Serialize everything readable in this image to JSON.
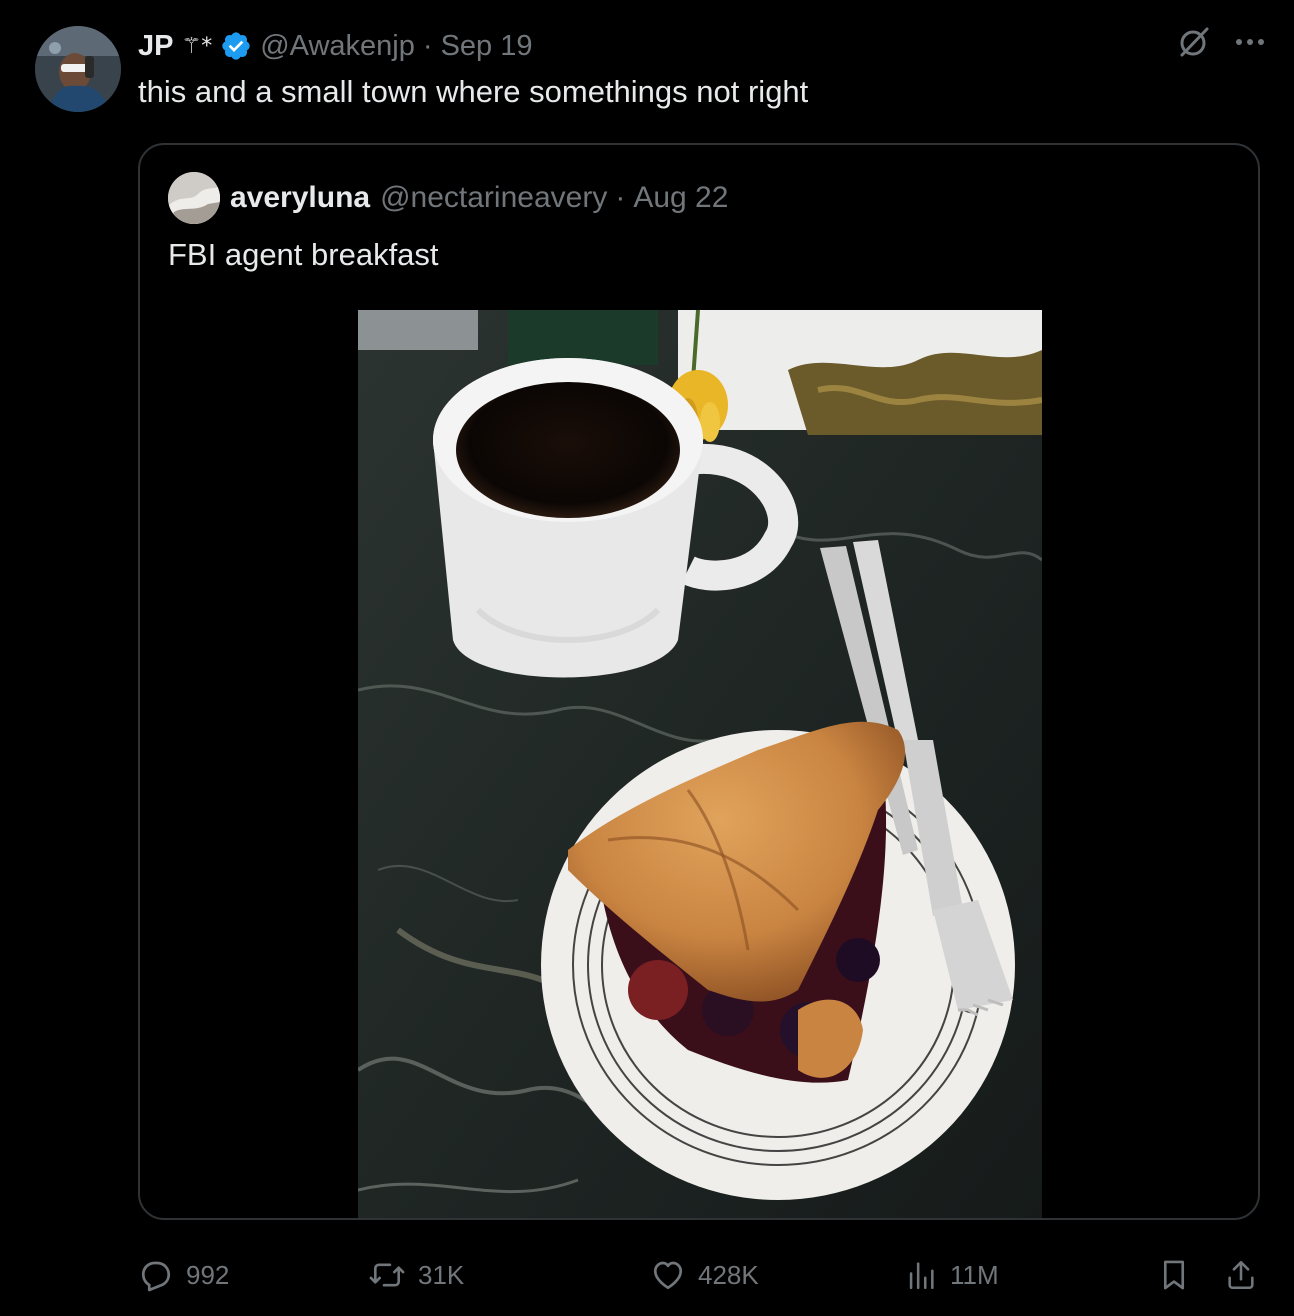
{
  "author": {
    "display_name": "JP",
    "name_glyph": "⚚*",
    "verified": true,
    "handle": "@Awakenjp",
    "separator": "·",
    "date": "Sep 19"
  },
  "tweet_text": "this and a small town where somethings not right",
  "quoted": {
    "display_name": "averyluna",
    "handle": "@nectarineavery",
    "separator": "·",
    "date": "Aug 22",
    "text": "FBI agent breakfast",
    "media_description_icon": "photo"
  },
  "actions": {
    "replies": "992",
    "reposts": "31K",
    "likes": "428K",
    "views": "11M"
  },
  "icons": {
    "verified": "verified-badge-icon",
    "grok": "grok-icon",
    "more": "more-icon",
    "reply": "reply-icon",
    "repost": "repost-icon",
    "like": "heart-icon",
    "views": "views-icon",
    "bookmark": "bookmark-icon",
    "share": "share-icon"
  },
  "colors": {
    "background": "#000000",
    "text_primary": "#e7e9ea",
    "text_secondary": "#71767b",
    "border": "#2f3336",
    "verified_blue": "#1d9bf0"
  }
}
